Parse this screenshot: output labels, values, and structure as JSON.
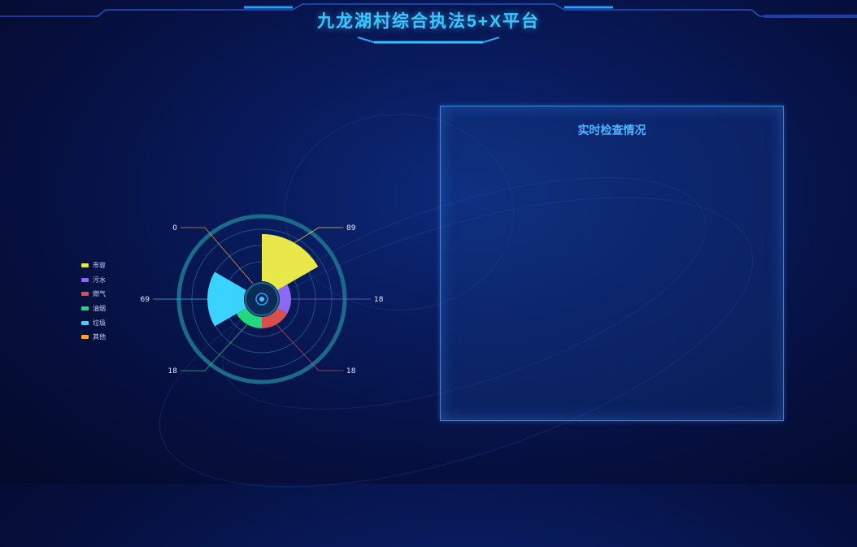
{
  "header": {
    "title": "九龙湖村综合执法5+X平台"
  },
  "panel": {
    "title": "实时检查情况"
  },
  "colors": {
    "accent": "#3cc6ff",
    "background": "#081a5a"
  },
  "chart_data": {
    "type": "pie",
    "variant": "nightingale-rose",
    "legend_position": "left",
    "categories": [
      "市容",
      "污水",
      "燃气",
      "油烟",
      "垃圾",
      "其他"
    ],
    "values": [
      89,
      18,
      18,
      18,
      69,
      0
    ],
    "colors": [
      "#e8e84a",
      "#8b6cf0",
      "#d8504e",
      "#22d87e",
      "#3ad2ff",
      "#f0a830"
    ],
    "data_labels": [
      "89",
      "18",
      "18",
      "18",
      "69",
      "0"
    ]
  }
}
